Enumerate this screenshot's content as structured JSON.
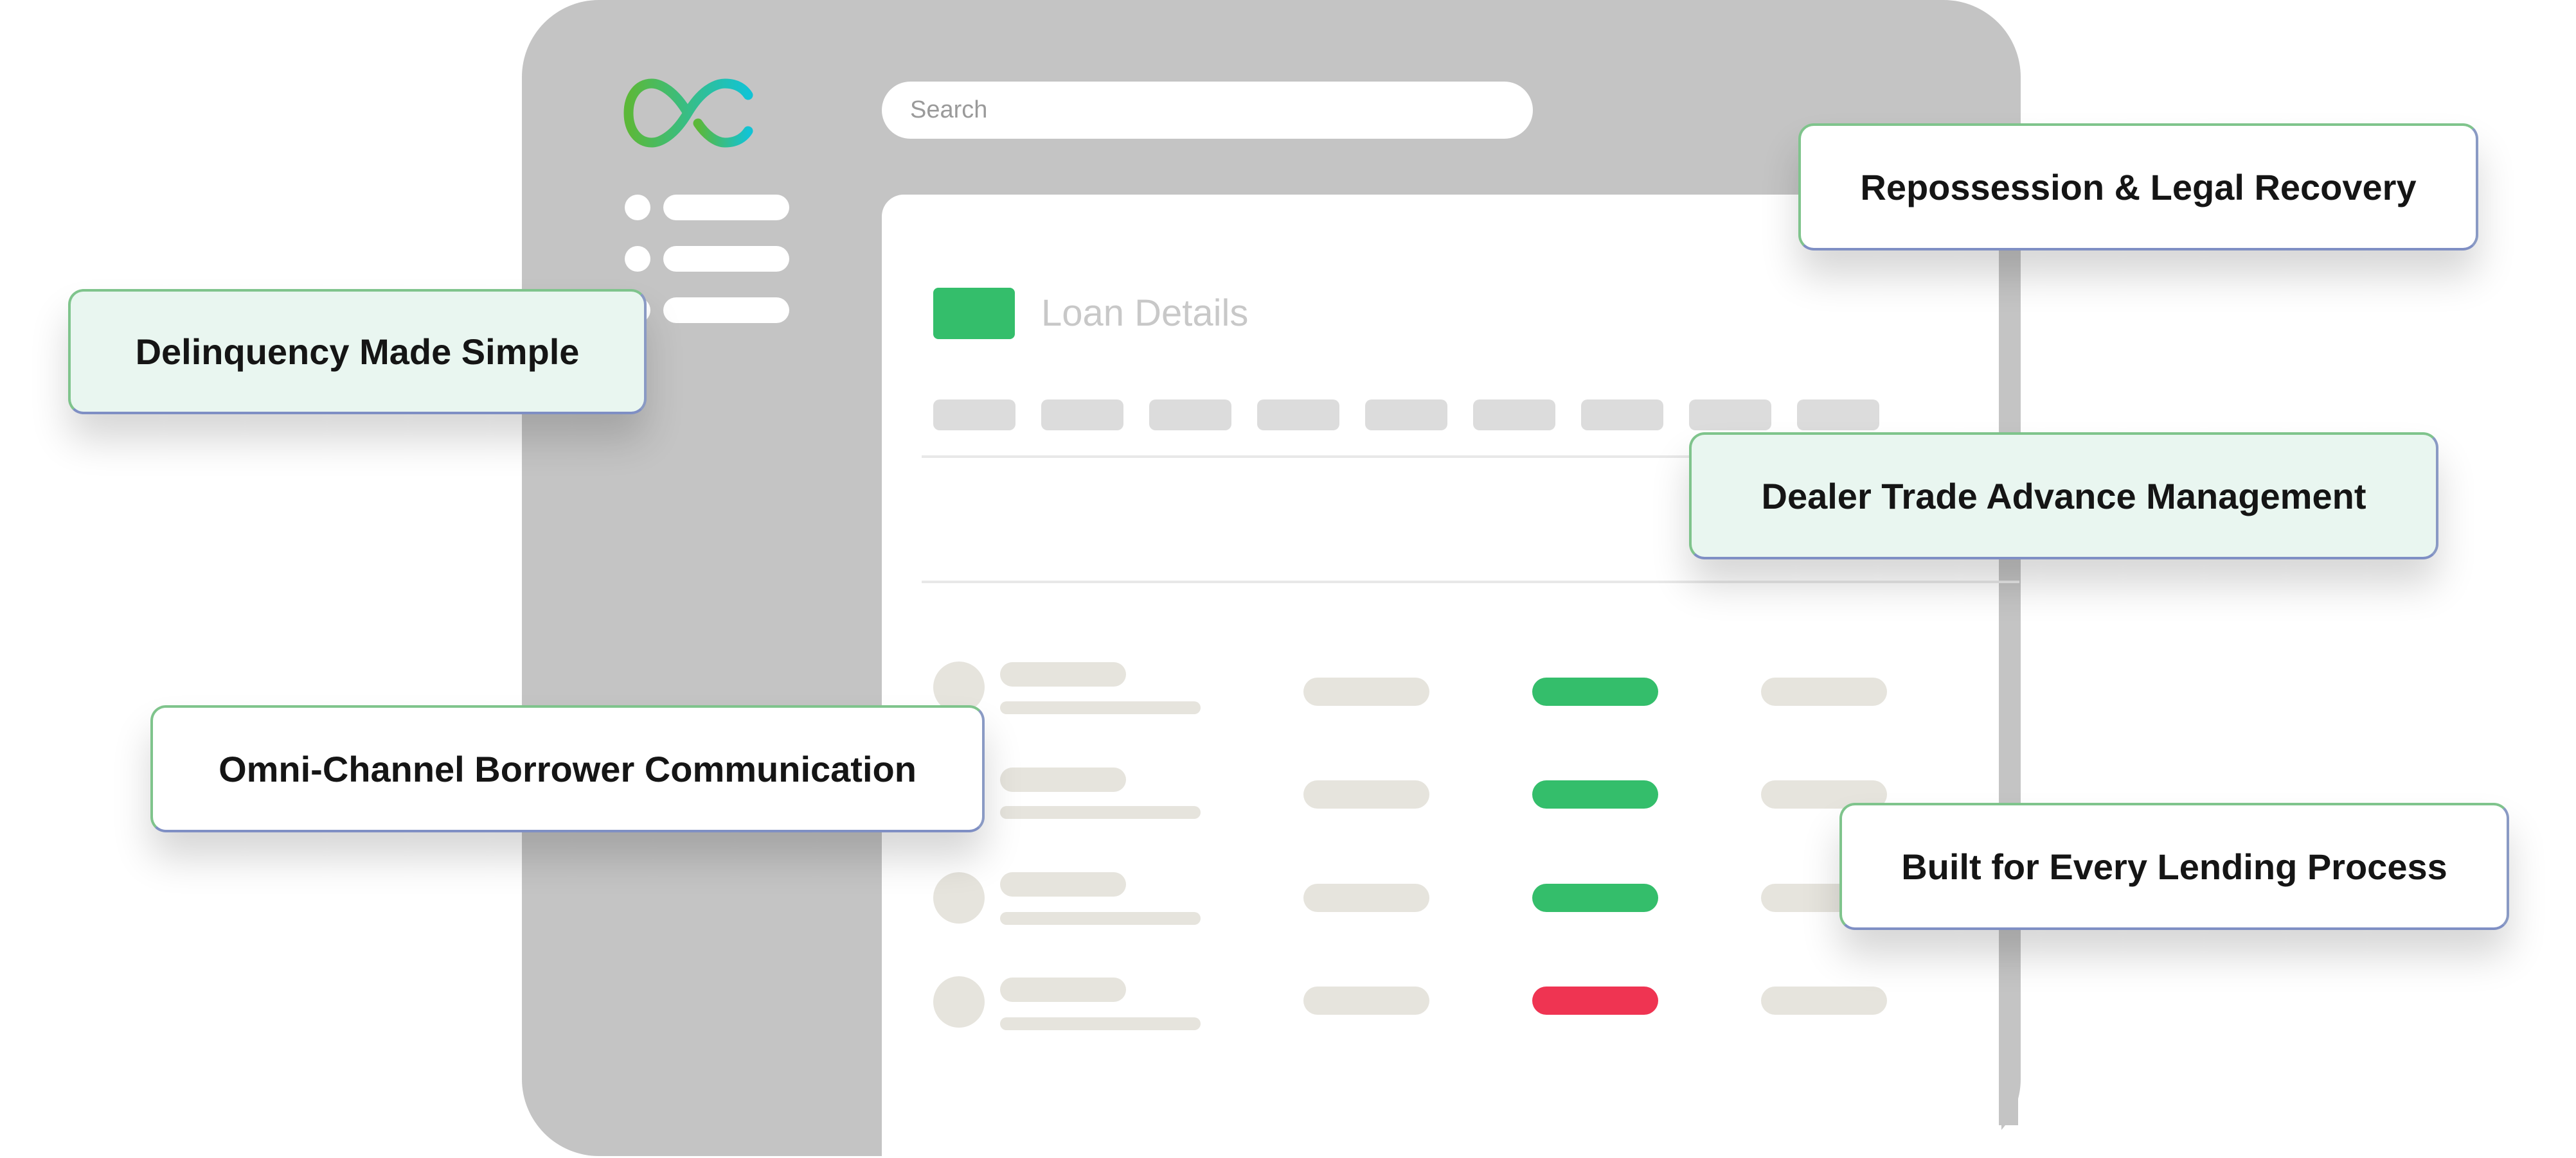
{
  "brand": {
    "logo_icon": "infinity-oc-logo-icon",
    "gradient_start": "#5cb839",
    "gradient_end": "#12c3d4"
  },
  "search": {
    "placeholder": "Search"
  },
  "panel": {
    "title_icon": "green-square-icon",
    "title": "Loan Details"
  },
  "rows": [
    {
      "status": "ok"
    },
    {
      "status": "ok"
    },
    {
      "status": "ok"
    },
    {
      "status": "alert"
    }
  ],
  "callouts": {
    "delinquency": "Delinquency Made Simple",
    "repossession": "Repossession & Legal Recovery",
    "dealer_trade": "Dealer Trade Advance Management",
    "omni_channel": "Omni-Channel Borrower Communication",
    "lending": "Built for Every Lending Process"
  },
  "colors": {
    "frame": "#c4c4c4",
    "accent_green": "#34be6b",
    "alert_red": "#ef3452",
    "skeleton": "#e6e4dd",
    "card_mint": "#e9f6f0"
  }
}
